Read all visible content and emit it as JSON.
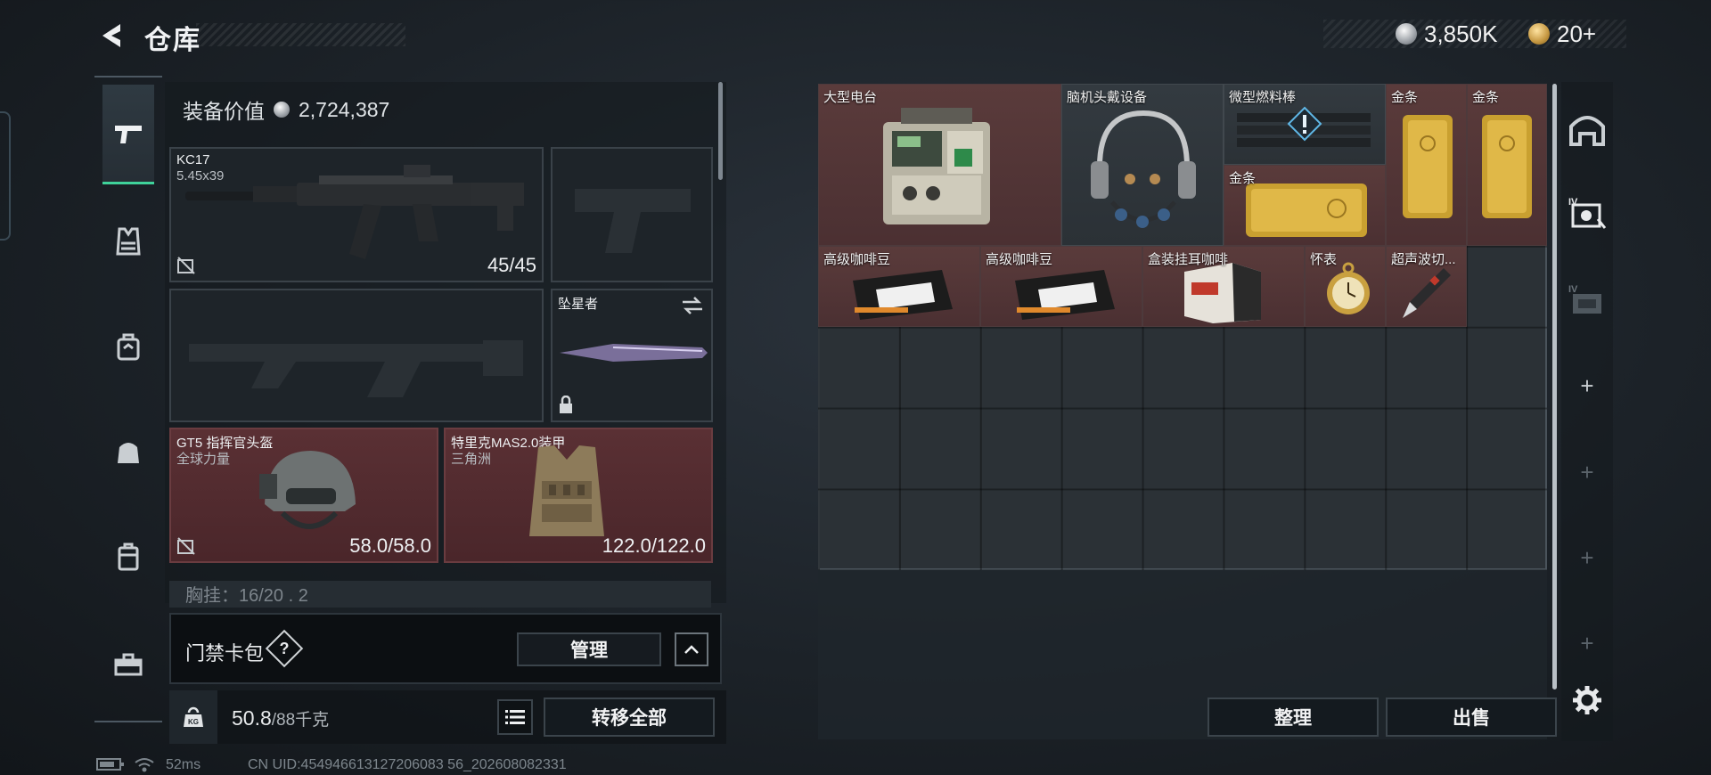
{
  "header": {
    "title": "仓库",
    "currency": [
      {
        "name": "哈夫币",
        "value": "3,850K",
        "icon": "silver-coin-icon"
      },
      {
        "name": "三角币",
        "value": "20+",
        "icon": "gold-coin-icon"
      }
    ]
  },
  "categories": [
    {
      "id": "weapon",
      "icon": "pistol-icon",
      "active": true
    },
    {
      "id": "armor",
      "icon": "vest-icon"
    },
    {
      "id": "chest-rig",
      "icon": "chest-rig-icon"
    },
    {
      "id": "backpack",
      "icon": "backpack-icon"
    },
    {
      "id": "case",
      "icon": "case-icon"
    },
    {
      "id": "toolbox",
      "icon": "toolbox-icon"
    }
  ],
  "loadout": {
    "value_label": "装备价值",
    "value": "2,724,387",
    "primary_weapon": {
      "name": "KC17",
      "ammo_type": "5.45x39",
      "ammo": "45/45"
    },
    "melee": {
      "name": "坠星者"
    },
    "helmet": {
      "name": "GT5 指挥官头盔",
      "sub": "全球力量",
      "durability": "58.0/58.0"
    },
    "armor": {
      "name": "特里克MAS2.0装甲",
      "sub": "三角洲",
      "durability": "122.0/122.0"
    },
    "chest_partial": "胸挂：16/20 . 2"
  },
  "access_card": {
    "label": "门禁卡包",
    "help": "?",
    "manage": "管理"
  },
  "weight": {
    "current": "50.8",
    "max": "/88千克",
    "icon_label": "KG"
  },
  "actions": {
    "transfer_all": "转移全部",
    "sort": "整理",
    "sell": "出售"
  },
  "storage_items": [
    {
      "name": "大型电台",
      "color": "red"
    },
    {
      "name": "脑机头戴设备",
      "color": "dark"
    },
    {
      "name": "微型燃料棒",
      "color": "dark"
    },
    {
      "name": "金条",
      "color": "red"
    },
    {
      "name": "金条",
      "color": "red"
    },
    {
      "name": "金条",
      "color": "red"
    },
    {
      "name": "高级咖啡豆",
      "color": "red"
    },
    {
      "name": "高级咖啡豆",
      "color": "red"
    },
    {
      "name": "盒装挂耳咖啡",
      "color": "red"
    },
    {
      "name": "怀表",
      "color": "red"
    },
    {
      "name": "超声波切...",
      "color": "red"
    }
  ],
  "status_bar": {
    "ping": "52ms",
    "uid": "CN UID:454946613127206083 56_202608082331"
  }
}
